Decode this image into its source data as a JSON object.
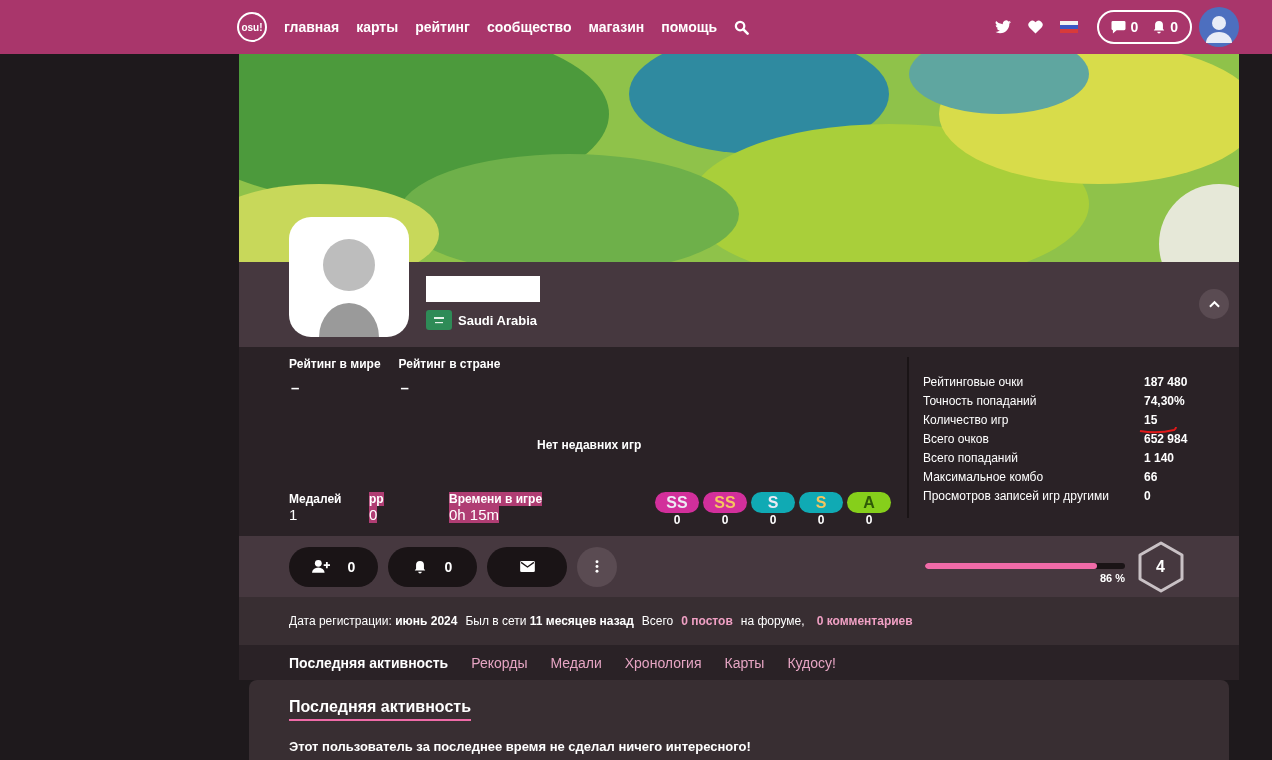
{
  "nav": {
    "logo": "osu!",
    "items": [
      {
        "label": "главная"
      },
      {
        "label": "карты"
      },
      {
        "label": "рейтинг"
      },
      {
        "label": "сообщество"
      },
      {
        "label": "магазин"
      },
      {
        "label": "помощь"
      }
    ],
    "chat_count": "0",
    "notification_count": "0"
  },
  "profile": {
    "country": "Saudi Arabia"
  },
  "ranks": [
    {
      "label": "Рейтинг в мире",
      "value": "–"
    },
    {
      "label": "Рейтинг в стране",
      "value": "–"
    }
  ],
  "no_recent": "Нет недавних игр",
  "summary": [
    {
      "label": "Медалей",
      "value": "1",
      "highlighted": false
    },
    {
      "label": "pp",
      "value": "0",
      "highlighted": true
    },
    {
      "label": "Времени в игре",
      "value": "0h 15m",
      "highlighted": true
    }
  ],
  "grades": [
    {
      "label": "SS",
      "kind": "ss-silver",
      "count": "0"
    },
    {
      "label": "SS",
      "kind": "ss-gold",
      "count": "0"
    },
    {
      "label": "S",
      "kind": "s-silver",
      "count": "0"
    },
    {
      "label": "S",
      "kind": "s-gold",
      "count": "0"
    },
    {
      "label": "A",
      "kind": "a",
      "count": "0"
    }
  ],
  "stats": [
    {
      "label": "Рейтинговые очки",
      "value": "187 480",
      "underlined": false
    },
    {
      "label": "Точность попаданий",
      "value": "74,30%",
      "underlined": false
    },
    {
      "label": "Количество игр",
      "value": "15",
      "underlined": true
    },
    {
      "label": "Всего очков",
      "value": "652 984",
      "underlined": false
    },
    {
      "label": "Всего попаданий",
      "value": "1 140",
      "underlined": false
    },
    {
      "label": "Максимальное комбо",
      "value": "66",
      "underlined": false
    },
    {
      "label": "Просмотров записей игр другими",
      "value": "0",
      "underlined": false
    }
  ],
  "actions": [
    {
      "kind": "friends",
      "count": "0"
    },
    {
      "kind": "subscribers",
      "count": "0"
    },
    {
      "kind": "message"
    },
    {
      "kind": "more"
    }
  ],
  "level": {
    "level": 0.86,
    "percent": "86 %",
    "value": "4"
  },
  "info": [
    {
      "text": "Дата регистрации: **июнь 2024**",
      "kind": "plain"
    },
    {
      "text": "Был в сети **11 месяцев назад**",
      "kind": "plain"
    },
    {
      "text": "Всего",
      "kind": "plain"
    },
    {
      "text": "0 постов",
      "kind": "link"
    },
    {
      "text": "на форуме,",
      "kind": "plain"
    },
    {
      "text": "0 комментариев",
      "kind": "link"
    }
  ],
  "tabs": [
    {
      "label": "Последняя активность",
      "selected": true
    },
    {
      "label": "Рекорды",
      "selected": false
    },
    {
      "label": "Медали",
      "selected": false
    },
    {
      "label": "Хронология",
      "selected": false
    },
    {
      "label": "Карты",
      "selected": false
    },
    {
      "label": "Кудосу!",
      "selected": false
    }
  ],
  "activity": {
    "title": "Последняя активность",
    "message": "Этот пользователь за последнее время не сделал ничего интересного!"
  }
}
